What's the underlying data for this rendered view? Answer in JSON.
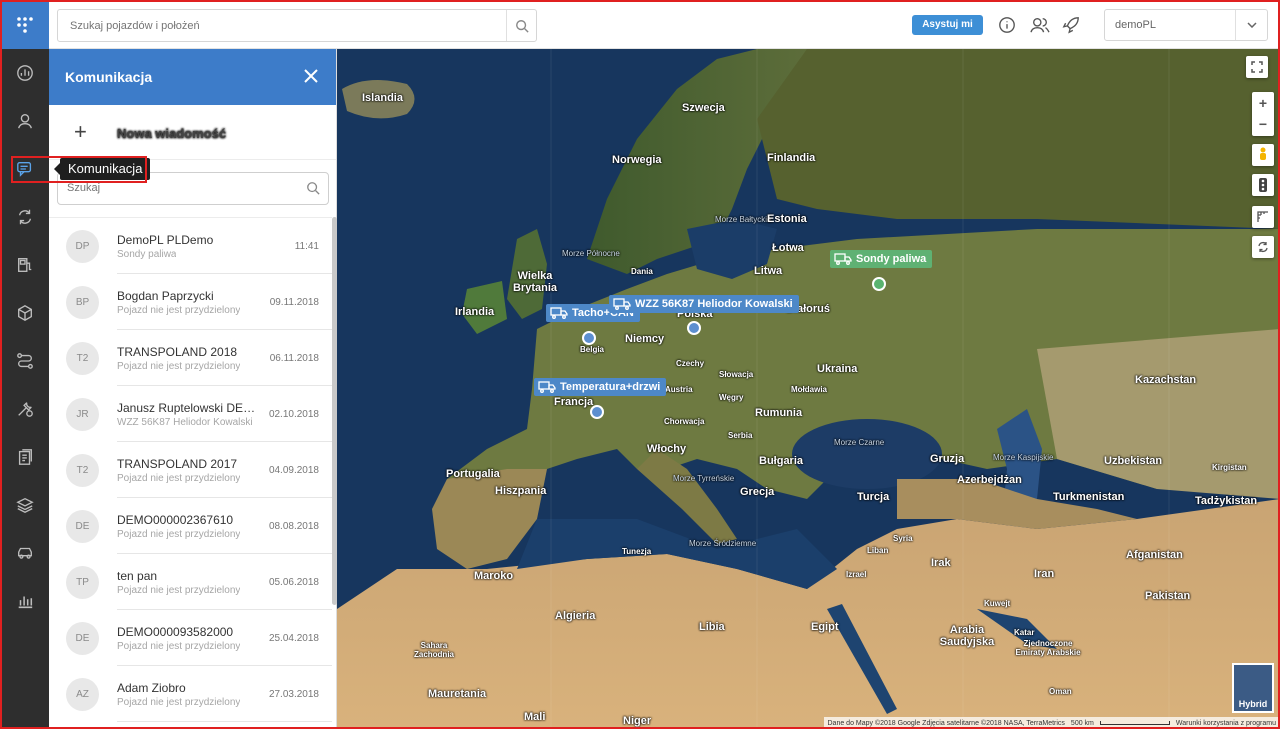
{
  "rail": {
    "tooltip": "Komunikacja",
    "items": [
      "dashboard-icon",
      "user-icon",
      "chat-icon",
      "sync-icon",
      "fuel-icon",
      "package-icon",
      "route-icon",
      "tools-icon",
      "documents-icon",
      "layers-icon",
      "car-icon",
      "chart-icon"
    ]
  },
  "topbar": {
    "search_placeholder": "Szukaj pojazdów i położeń",
    "assist_label": "Asystuj mi",
    "account": "demoPL"
  },
  "panel": {
    "title": "Komunikacja",
    "new_message": "Nowa wiadomość",
    "search_placeholder": "Szukaj",
    "conversations": [
      {
        "initials": "DP",
        "name": "DemoPL PLDemo",
        "sub": "Sondy paliwa",
        "date": "11:41"
      },
      {
        "initials": "BP",
        "name": "Bogdan Paprzycki",
        "sub": "Pojazd nie jest przydzielony",
        "date": "09.11.2018"
      },
      {
        "initials": "T2",
        "name": "TRANSPOLAND 2018",
        "sub": "Pojazd nie jest przydzielony",
        "date": "06.11.2018"
      },
      {
        "initials": "JR",
        "name": "Janusz Ruptelowski DEM...",
        "sub": "WZZ 56K87 Heliodor Kowalski",
        "date": "02.10.2018"
      },
      {
        "initials": "T2",
        "name": "TRANSPOLAND 2017",
        "sub": "Pojazd nie jest przydzielony",
        "date": "04.09.2018"
      },
      {
        "initials": "DE",
        "name": "DEMO000002367610",
        "sub": "Pojazd nie jest przydzielony",
        "date": "08.08.2018"
      },
      {
        "initials": "TP",
        "name": "ten pan",
        "sub": "Pojazd nie jest przydzielony",
        "date": "05.06.2018"
      },
      {
        "initials": "DE",
        "name": "DEMO000093582000",
        "sub": "Pojazd nie jest przydzielony",
        "date": "25.04.2018"
      },
      {
        "initials": "AZ",
        "name": "Adam Ziobro",
        "sub": "Pojazd nie jest przydzielony",
        "date": "27.03.2018"
      }
    ]
  },
  "map": {
    "vehicles": {
      "tacho": "Tacho+CAN",
      "wzz": "WZZ 56K87 Heliodor Kowalski",
      "sondy": "Sondy paliwa",
      "temp": "Temperatura+drzwi"
    },
    "labels": {
      "islandia": "Islandia",
      "szwecja": "Szwecja",
      "norwegia": "Norwegia",
      "finlandia": "Finlandia",
      "estonia": "Estonia",
      "lotwa": "Łotwa",
      "litwa": "Litwa",
      "dania": "Dania",
      "wb": "Wielka Brytania",
      "irlandia": "Irlandia",
      "bialorus": "Białoruś",
      "polska": "Polska",
      "niemcy": "Niemcy",
      "belgia": "Belgia",
      "czechy": "Czechy",
      "slowacja": "Słowacja",
      "austria": "Austria",
      "wegry": "Węgry",
      "moldawia": "Mołdawia",
      "ukraina": "Ukraina",
      "francja": "Francja",
      "rumunia": "Rumunia",
      "chorwacja": "Chorwacja",
      "serbia": "Serbia",
      "wlochy": "Włochy",
      "bulgaria": "Bułgaria",
      "portugalia": "Portugalia",
      "hiszpania": "Hiszpania",
      "grecja": "Grecja",
      "turcja": "Turcja",
      "gruzja": "Gruzja",
      "azerbejdzan": "Azerbejdżan",
      "kazachstan": "Kazachstan",
      "uzbekistan": "Uzbekistan",
      "turkmenistan": "Turkmenistan",
      "kirgistan": "Kirgistan",
      "tadzykistan": "Tadżykistan",
      "syria": "Syria",
      "liban": "Liban",
      "irak": "Irak",
      "izrael": "Izrael",
      "iran": "Iran",
      "afganistan": "Afganistan",
      "pakistan": "Pakistan",
      "tunezja": "Tunezja",
      "maroko": "Maroko",
      "algieria": "Algieria",
      "libia": "Libia",
      "egipt": "Egipt",
      "arabia": "Arabia Saudyjska",
      "zjedn": "Zjednoczone Emiraty Arabskie",
      "oman": "Oman",
      "sahara": "Sahara Zachodnia",
      "mauretania": "Mauretania",
      "mali": "Mali",
      "niger": "Niger",
      "kuwejt": "Kuwejt",
      "katar": "Katar",
      "kaspijskie": "Morze Kaspijskie",
      "czarne": "Morze Czarne",
      "baltyckie": "Morze Bałtyckie",
      "polnocne": "Morze Północne",
      "tyrrenskie": "Morze Tyrreńskie",
      "srodziemne": "Morze Śródziemne"
    },
    "hybrid_label": "Hybrid",
    "attribution": "Dane do Mapy ©2018 Google Zdjęcia satelitarne ©2018 NASA, TerraMetrics",
    "scale": "500 km",
    "terms": "Warunki korzystania z programu"
  }
}
